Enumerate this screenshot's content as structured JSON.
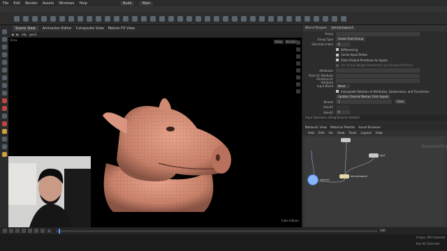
{
  "menubar": {
    "items": [
      "File",
      "Edit",
      "Render",
      "Assets",
      "Windows",
      "Help"
    ],
    "build_label": "Build",
    "main_label": "Main"
  },
  "viewport": {
    "tab_label": "Scene View",
    "tab2_label": "Animation Editor",
    "tab3_label": "Composite View",
    "tab4_label": "Motion FX View",
    "path": "obj",
    "node_path": "geo1",
    "view_label": "View",
    "persp_label": "Persp",
    "cam_label": "No cam",
    "watermark": "Indie Edition"
  },
  "param_panel": {
    "title": "Blend Shapes",
    "node_name": "blendshapes1",
    "rows": [
      {
        "label": "Group",
        "value": ""
      },
      {
        "label": "Group Type",
        "value": "Guess from Group"
      },
      {
        "label": "Selection Index",
        "value": "0"
      },
      {
        "label": "",
        "value": "Differencing",
        "checked": true
      },
      {
        "label": "",
        "value": "Cache Input Deltas",
        "checked": true
      },
      {
        "label": "",
        "value": "Fetch Packed Primitives As Inputs",
        "checked": true
      },
      {
        "label": "",
        "value": "Use Actual Weight Parameters per Packed Primitive",
        "checked": false
      },
      {
        "label": "Attributes",
        "value": ""
      },
      {
        "label": "Point Or Attribute",
        "value": ""
      },
      {
        "label": "Primitive Or Attribute",
        "value": ""
      },
      {
        "label": "Input Blend",
        "value": "None"
      },
      {
        "label": "",
        "value": "Interpolate Rotation of Attributes, Quaternions, and Transforms",
        "checked": true
      },
      {
        "label": "",
        "value": "Update Channel Names From Inputs",
        "checked": false
      },
      {
        "label": "Blends",
        "value": "1"
      },
      {
        "label": "blend1",
        "value": ""
      },
      {
        "label": "blend2",
        "value": "0"
      }
    ],
    "clear_label": "Clear",
    "footer": "Input Operators (Drag Drop to reorder)"
  },
  "network_panel": {
    "tabs": [
      "Network View",
      "Material Palette",
      "Asset Browser"
    ],
    "path": "geo1",
    "menu": [
      "Add",
      "Edit",
      "Go",
      "View",
      "Tools",
      "Layout",
      "Help"
    ],
    "context_label": "Geometry",
    "nodes": [
      "blendshapes1",
      "pig",
      "pig1",
      "sphere1",
      "blendshapes2"
    ]
  },
  "timeline": {
    "frame": "1",
    "end_frame": "240",
    "end2": "240"
  },
  "status": {
    "keys_label": "0 keys, 0/0 channels",
    "key_all": "Key All Channels"
  }
}
